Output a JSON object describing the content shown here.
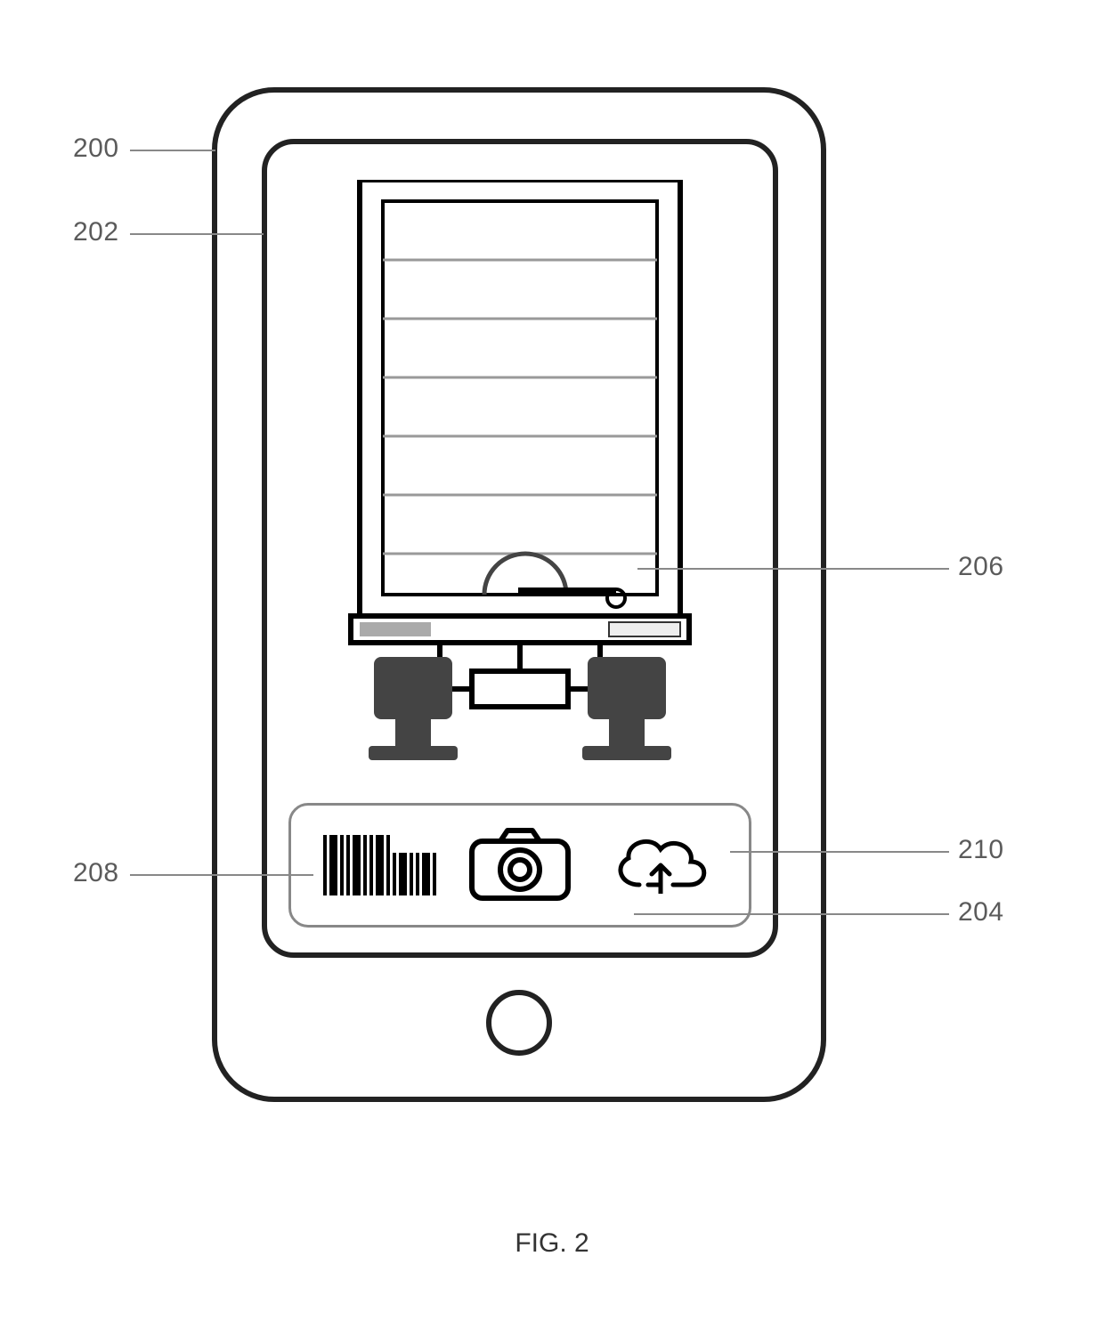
{
  "figure_caption": "FIG. 2",
  "callouts": {
    "device": "200",
    "screen": "202",
    "toolbar": "204",
    "viewport_image": "206",
    "barcode_button": "208",
    "upload_button": "210"
  }
}
